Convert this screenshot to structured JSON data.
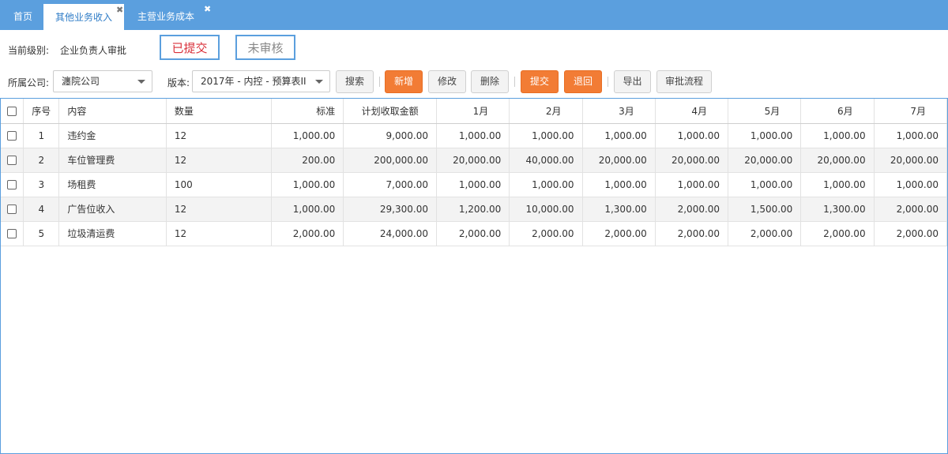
{
  "tabs": {
    "home": "首页",
    "active": "其他业务收入",
    "other": "主营业务成本",
    "close_glyph": "✖"
  },
  "status": {
    "level_label": "当前级别:",
    "level_value": "企业负责人审批",
    "submitted": "已提交",
    "unaudited": "未审核"
  },
  "filters": {
    "company_label": "所属公司:",
    "company_value": "瀍院公司",
    "version_label": "版本:",
    "version_value": "2017年 - 内控 - 预算表II"
  },
  "toolbar": {
    "search": "搜索",
    "add": "新增",
    "edit": "修改",
    "delete": "删除",
    "submit": "提交",
    "return": "退回",
    "export": "导出",
    "flow": "审批流程"
  },
  "colors": {
    "tabbar": "#5b9fde",
    "accent_orange": "#f27c35",
    "submitted_red": "#d9303a"
  },
  "table": {
    "headers": [
      "序号",
      "内容",
      "数量",
      "标准",
      "计划收取金额",
      "1月",
      "2月",
      "3月",
      "4月",
      "5月",
      "6月",
      "7月"
    ],
    "rows": [
      [
        "1",
        "违约金",
        "12",
        "1,000.00",
        "9,000.00",
        "1,000.00",
        "1,000.00",
        "1,000.00",
        "1,000.00",
        "1,000.00",
        "1,000.00",
        "1,000.00"
      ],
      [
        "2",
        "车位管理费",
        "12",
        "200.00",
        "200,000.00",
        "20,000.00",
        "40,000.00",
        "20,000.00",
        "20,000.00",
        "20,000.00",
        "20,000.00",
        "20,000.00"
      ],
      [
        "3",
        "场租费",
        "100",
        "1,000.00",
        "7,000.00",
        "1,000.00",
        "1,000.00",
        "1,000.00",
        "1,000.00",
        "1,000.00",
        "1,000.00",
        "1,000.00"
      ],
      [
        "4",
        "广告位收入",
        "12",
        "1,000.00",
        "29,300.00",
        "1,200.00",
        "10,000.00",
        "1,300.00",
        "2,000.00",
        "1,500.00",
        "1,300.00",
        "2,000.00"
      ],
      [
        "5",
        "垃圾清运费",
        "12",
        "2,000.00",
        "24,000.00",
        "2,000.00",
        "2,000.00",
        "2,000.00",
        "2,000.00",
        "2,000.00",
        "2,000.00",
        "2,000.00"
      ]
    ]
  }
}
